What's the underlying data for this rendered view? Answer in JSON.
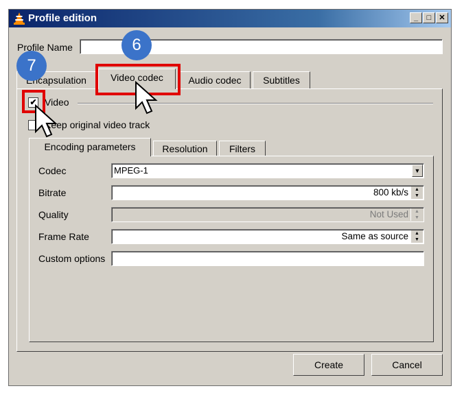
{
  "window": {
    "title": "Profile edition",
    "min_icon": "_",
    "max_icon": "□",
    "close_icon": "✕"
  },
  "profile": {
    "label": "Profile Name",
    "value": ""
  },
  "tabs": [
    {
      "label": "Encapsulation",
      "active": false
    },
    {
      "label": "Video codec",
      "active": true
    },
    {
      "label": "Audio codec",
      "active": false
    },
    {
      "label": "Subtitles",
      "active": false
    }
  ],
  "video": {
    "checkbox_label": "Video",
    "checked": true,
    "keep_original_label": "Keep original video track",
    "keep_original_checked": false
  },
  "subtabs": [
    {
      "label": "Encoding parameters",
      "active": true
    },
    {
      "label": "Resolution",
      "active": false
    },
    {
      "label": "Filters",
      "active": false
    }
  ],
  "encoding": {
    "codec_label": "Codec",
    "codec_value": "MPEG-1",
    "bitrate_label": "Bitrate",
    "bitrate_value": "800 kb/s",
    "quality_label": "Quality",
    "quality_value": "Not Used",
    "framerate_label": "Frame Rate",
    "framerate_value": "Same as source",
    "custom_label": "Custom options",
    "custom_value": ""
  },
  "buttons": {
    "create": "Create",
    "cancel": "Cancel"
  },
  "annotations": {
    "badge_6": "6",
    "badge_7": "7"
  },
  "colors": {
    "highlight": "#e00000",
    "badge": "#3b73c9",
    "titlebar": "#0a246a"
  }
}
